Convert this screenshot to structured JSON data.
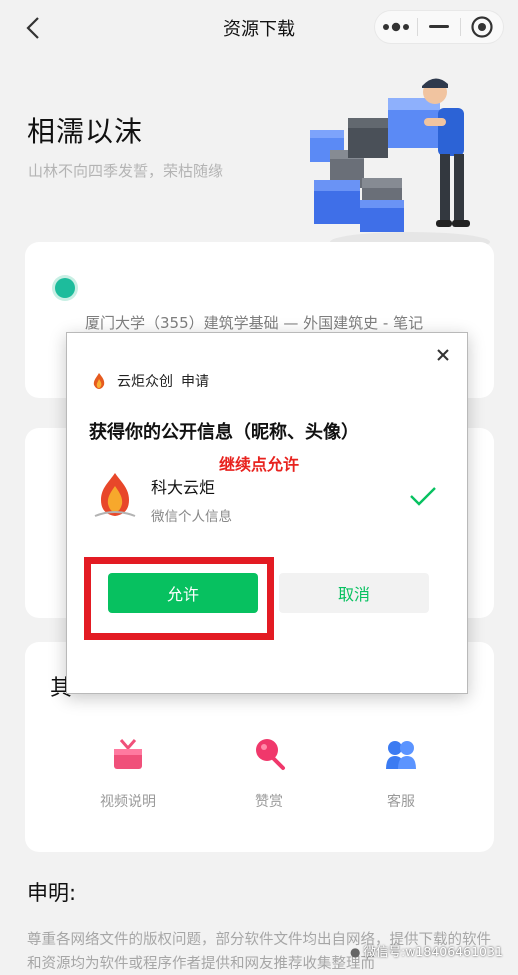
{
  "nav": {
    "title": "资源下载",
    "back_icon": "chevron-left-icon",
    "capsule_icons": [
      "more-dots-icon",
      "minimize-icon",
      "close-target-icon"
    ]
  },
  "hero": {
    "title": "相濡以沫",
    "subtitle": "山林不向四季发誓，荣枯随缘",
    "illustration": "delivery-man-carrying-boxes"
  },
  "resource": {
    "selected": true,
    "text": "厦门大学（355）建筑学基础 — 外国建筑史 - 笔记"
  },
  "other": {
    "heading": "其",
    "tools": [
      {
        "label": "视频说明",
        "icon": "gift-video-icon"
      },
      {
        "label": "赞赏",
        "icon": "lollipop-reward-icon"
      },
      {
        "label": "客服",
        "icon": "customer-service-icon"
      }
    ]
  },
  "statement": {
    "title": "申明:",
    "body": "尊重各网络文件的版权问题，部分软件文件均出自网络，提供下载的软件和资源均为软件或程序作者提供和网友推荐收集整理而"
  },
  "watermark": "微信号:w18406461031",
  "dialog": {
    "app_name": "云炬众创",
    "app_action": "申请",
    "heading": "获得你的公开信息（昵称、头像）",
    "annotation": "继续点允许",
    "user_name": "科大云炬",
    "user_desc": "微信个人信息",
    "allow_label": "允许",
    "cancel_label": "取消"
  },
  "colors": {
    "allow_green": "#07c160",
    "radio_teal": "#1dbc9c",
    "highlight_red": "#e31b23",
    "annotation_red": "#e8231f"
  }
}
